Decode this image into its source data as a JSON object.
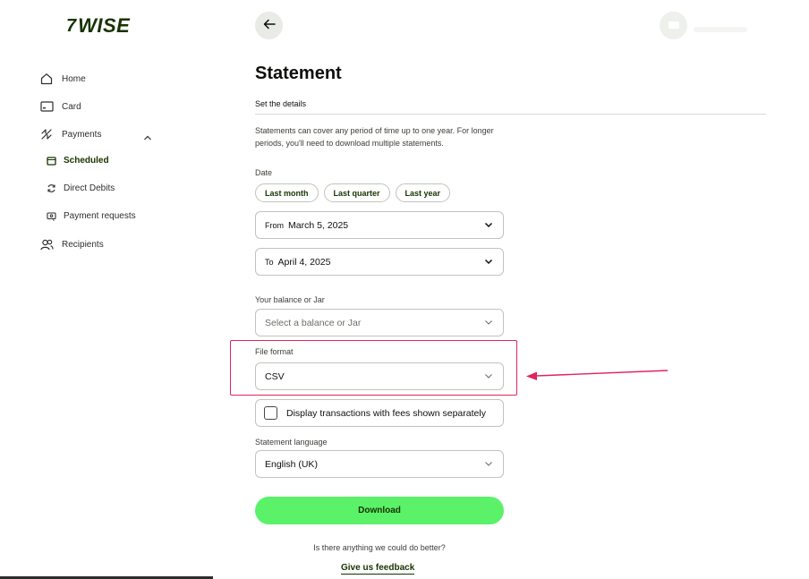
{
  "brand": {
    "flag": "7",
    "name": "WISE"
  },
  "sidebar": {
    "items": [
      {
        "label": "Home",
        "icon": "home-icon"
      },
      {
        "label": "Card",
        "icon": "card-icon"
      },
      {
        "label": "Payments",
        "icon": "payments-icon"
      },
      {
        "label": "Scheduled",
        "icon": "calendar-icon",
        "active": true
      },
      {
        "label": "Direct Debits",
        "icon": "refresh-icon"
      },
      {
        "label": "Payment requests",
        "icon": "request-icon"
      },
      {
        "label": "Recipients",
        "icon": "people-icon"
      }
    ]
  },
  "page": {
    "title": "Statement",
    "section": "Set the details",
    "description": "Statements can cover any period of time up to one year. For longer periods, you'll need to download multiple statements."
  },
  "date": {
    "label": "Date",
    "chips": [
      "Last month",
      "Last quarter",
      "Last year"
    ],
    "from_prefix": "From",
    "from_value": "March 5, 2025",
    "to_prefix": "To",
    "to_value": "April 4, 2025"
  },
  "balance": {
    "label": "Your balance or Jar",
    "placeholder": "Select a balance or Jar"
  },
  "file_format": {
    "label": "File format",
    "value": "CSV"
  },
  "fees_checkbox": {
    "label": "Display transactions with fees shown separately",
    "checked": false
  },
  "language": {
    "label": "Statement language",
    "value": "English (UK)"
  },
  "download_label": "Download",
  "feedback": {
    "question": "Is there anything we could do better?",
    "link": "Give us feedback"
  },
  "colors": {
    "brand_green": "#163300",
    "accent_green": "#5bf26a",
    "highlight": "#e0245e"
  }
}
